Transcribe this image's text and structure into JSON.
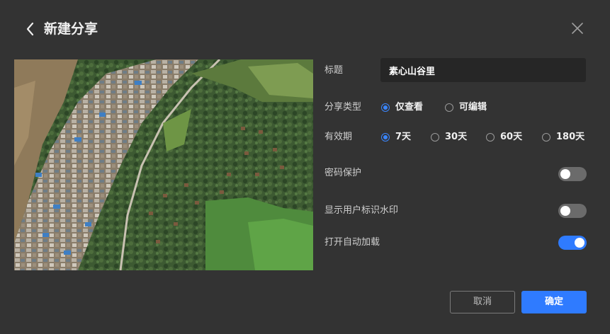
{
  "dialog": {
    "title": "新建分享",
    "icons": {
      "back": "chevron-left-icon",
      "close": "close-icon"
    }
  },
  "form": {
    "title_label": "标题",
    "title_value": "素心山谷里",
    "share_type_label": "分享类型",
    "share_type_options": [
      "仅查看",
      "可编辑"
    ],
    "share_type_selected": "仅查看",
    "validity_label": "有效期",
    "validity_options": [
      "7天",
      "30天",
      "60天",
      "180天"
    ],
    "validity_selected": "7天",
    "password_label": "密码保护",
    "password_enabled": false,
    "watermark_label": "显示用户标识水印",
    "watermark_enabled": false,
    "autoload_label": "打开自动加载",
    "autoload_enabled": true
  },
  "buttons": {
    "cancel": "取消",
    "ok": "确定"
  },
  "colors": {
    "background": "#333333",
    "accent": "#2f7bff",
    "input_bg": "#262626",
    "toggle_off": "#6b6b6b"
  }
}
